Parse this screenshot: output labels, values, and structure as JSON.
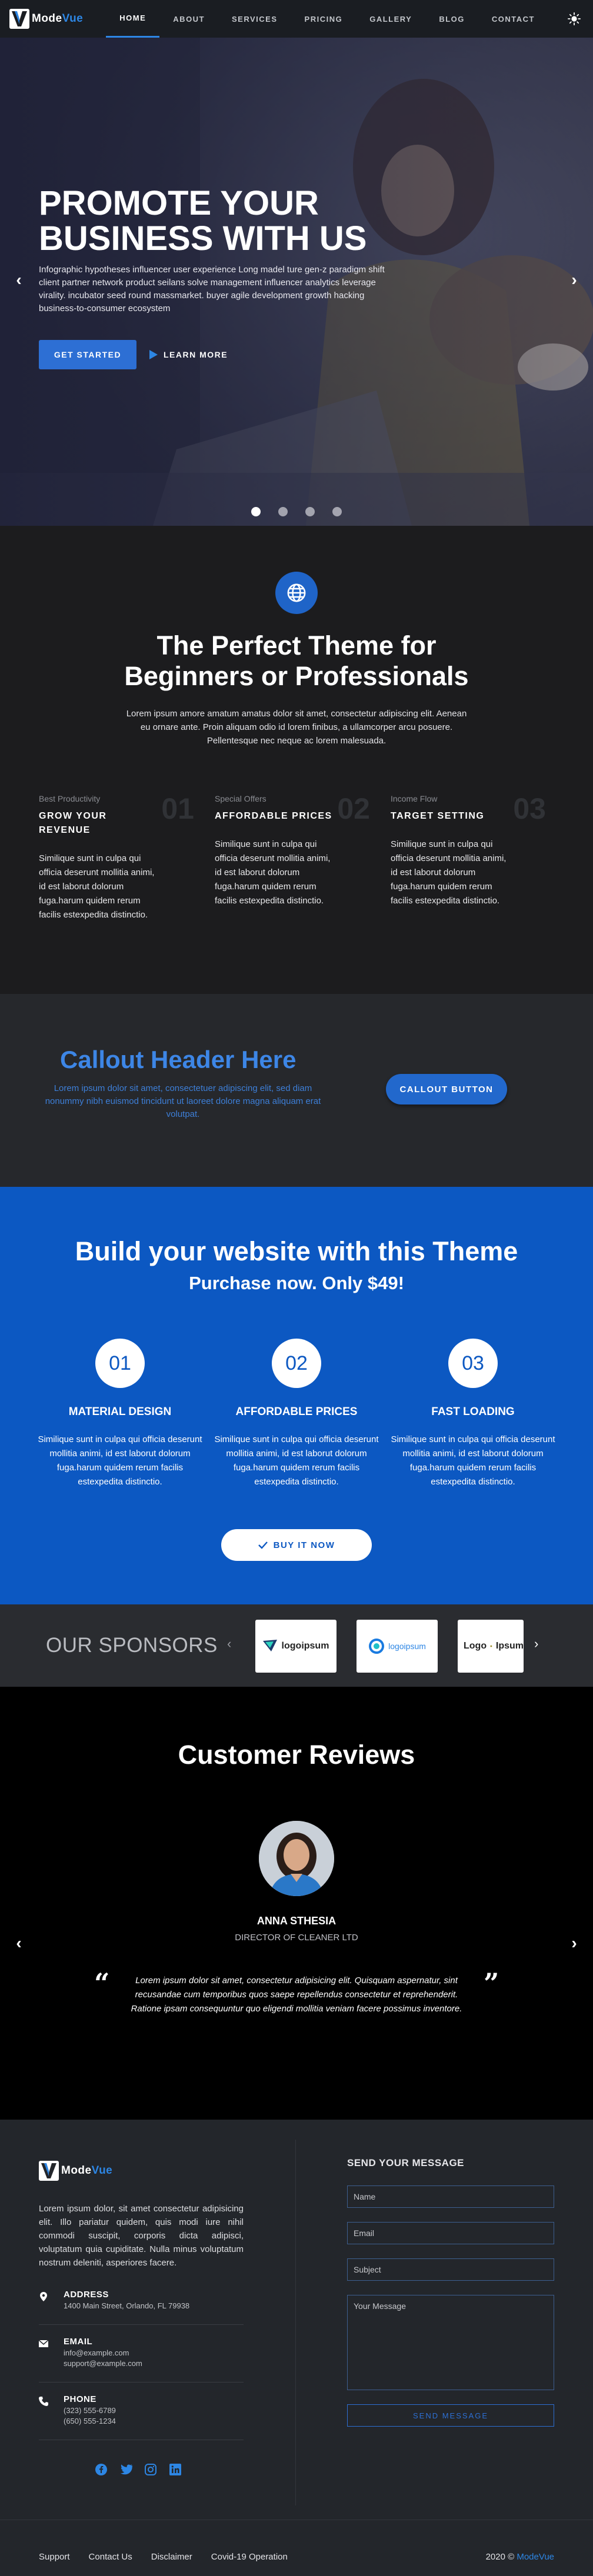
{
  "brand": {
    "name_part1": "Mode",
    "name_part2": "Vue"
  },
  "nav": {
    "items": [
      "HOME",
      "ABOUT",
      "SERVICES",
      "PRICING",
      "GALLERY",
      "BLOG",
      "CONTACT"
    ],
    "active_index": 0,
    "theme_toggle_icon": "sun-icon"
  },
  "hero": {
    "title_line1": "PROMOTE YOUR",
    "title_line2": "BUSINESS WITH US",
    "text": "Infographic hypotheses influencer user experience Long madel ture gen-z paradigm shift client partner network product seilans solve management influencer analytics leverage virality. incubator seed round massmarket. buyer agile development growth hacking business-to-consumer ecosystem",
    "primary_button": "GET STARTED",
    "secondary_button": "LEARN MORE",
    "slides": 4,
    "active_slide": 0
  },
  "features": {
    "icon": "globe-icon",
    "title_line1": "The Perfect Theme for",
    "title_line2": "Beginners or Professionals",
    "subtitle": "Lorem ipsum amore amatum amatus dolor sit amet, consectetur adipiscing elit. Aenean eu ornare ante. Proin aliquam odio id lorem finibus, a ullamcorper arcu posuere. Pellentesque nec neque ac lorem malesuada.",
    "items": [
      {
        "number": "01",
        "kicker": "Best Productivity",
        "heading": "GROW YOUR REVENUE",
        "text": "Similique sunt in culpa qui officia deserunt mollitia animi, id est laborut dolorum fuga.harum quidem rerum facilis estexpedita distinctio."
      },
      {
        "number": "02",
        "kicker": "Special Offers",
        "heading": "AFFORDABLE PRICES",
        "text": "Similique sunt in culpa qui officia deserunt mollitia animi, id est laborut dolorum fuga.harum quidem rerum facilis estexpedita distinctio."
      },
      {
        "number": "03",
        "kicker": "Income Flow",
        "heading": "TARGET SETTING",
        "text": "Similique sunt in culpa qui officia deserunt mollitia animi, id est laborut dolorum fuga.harum quidem rerum facilis estexpedita distinctio."
      }
    ]
  },
  "callout": {
    "header": "Callout Header Here",
    "text": "Lorem ipsum dolor sit amet, consectetuer adipiscing elit, sed diam nonummy nibh euismod tincidunt ut laoreet dolore magna aliquam erat volutpat.",
    "button": "CALLOUT BUTTON"
  },
  "build": {
    "title": "Build your website with this Theme",
    "subtitle": "Purchase now. Only $49!",
    "items": [
      {
        "number": "01",
        "heading": "MATERIAL DESIGN",
        "text": "Similique sunt in culpa qui officia deserunt mollitia animi, id est laborut dolorum fuga.harum quidem rerum facilis estexpedita distinctio."
      },
      {
        "number": "02",
        "heading": "AFFORDABLE PRICES",
        "text": "Similique sunt in culpa qui officia deserunt mollitia animi, id est laborut dolorum fuga.harum quidem rerum facilis estexpedita distinctio."
      },
      {
        "number": "03",
        "heading": "FAST LOADING",
        "text": "Similique sunt in culpa qui officia deserunt mollitia animi, id est laborut dolorum fuga.harum quidem rerum facilis estexpedita distinctio."
      }
    ],
    "buy_button": "BUY IT NOW"
  },
  "sponsors": {
    "heading": "OUR SPONSORS",
    "logos": [
      "logoipsum",
      "logoipsum",
      "Logo",
      "Ipsum"
    ]
  },
  "reviews": {
    "title": "Customer Reviews",
    "name": "ANNA STHESIA",
    "role": "DIRECTOR OF CLEANER LTD",
    "quote": "Lorem ipsum dolor sit amet, consectetur adipisicing elit. Quisquam aspernatur, sint recusandae cum temporibus quos saepe repellendus consectetur et reprehenderit. Ratione ipsam consequuntur quo eligendi mollitia veniam facere possimus inventore."
  },
  "footer": {
    "description": "Lorem ipsum dolor, sit amet consectetur adipisicing elit. Illo pariatur quidem, quis modi iure nihil commodi suscipit, corporis dicta adipisci, voluptatum quia cupiditate. Nulla minus voluptatum nostrum deleniti, asperiores facere.",
    "address_label": "ADDRESS",
    "address_value": "1400 Main Street, Orlando, FL 79938",
    "email_label": "EMAIL",
    "email_value1": "info@example.com",
    "email_value2": "support@example.com",
    "phone_label": "PHONE",
    "phone_value1": "(323) 555-6789",
    "phone_value2": "(650) 555-1234",
    "form_title": "SEND YOUR MESSAGE",
    "name_placeholder": "Name",
    "email_placeholder": "Email",
    "subject_placeholder": "Subject",
    "message_placeholder": "Your Message",
    "send_button": "SEND MESSAGE",
    "links": [
      "Support",
      "Contact Us",
      "Disclaimer",
      "Covid-19 Operation"
    ],
    "copyright_year": "2020 ©",
    "copyright_brand": "ModeVue"
  },
  "colors": {
    "accent": "#2d86e4",
    "build_bg": "#0c58c2",
    "dark_bg": "#1c1c1e"
  }
}
